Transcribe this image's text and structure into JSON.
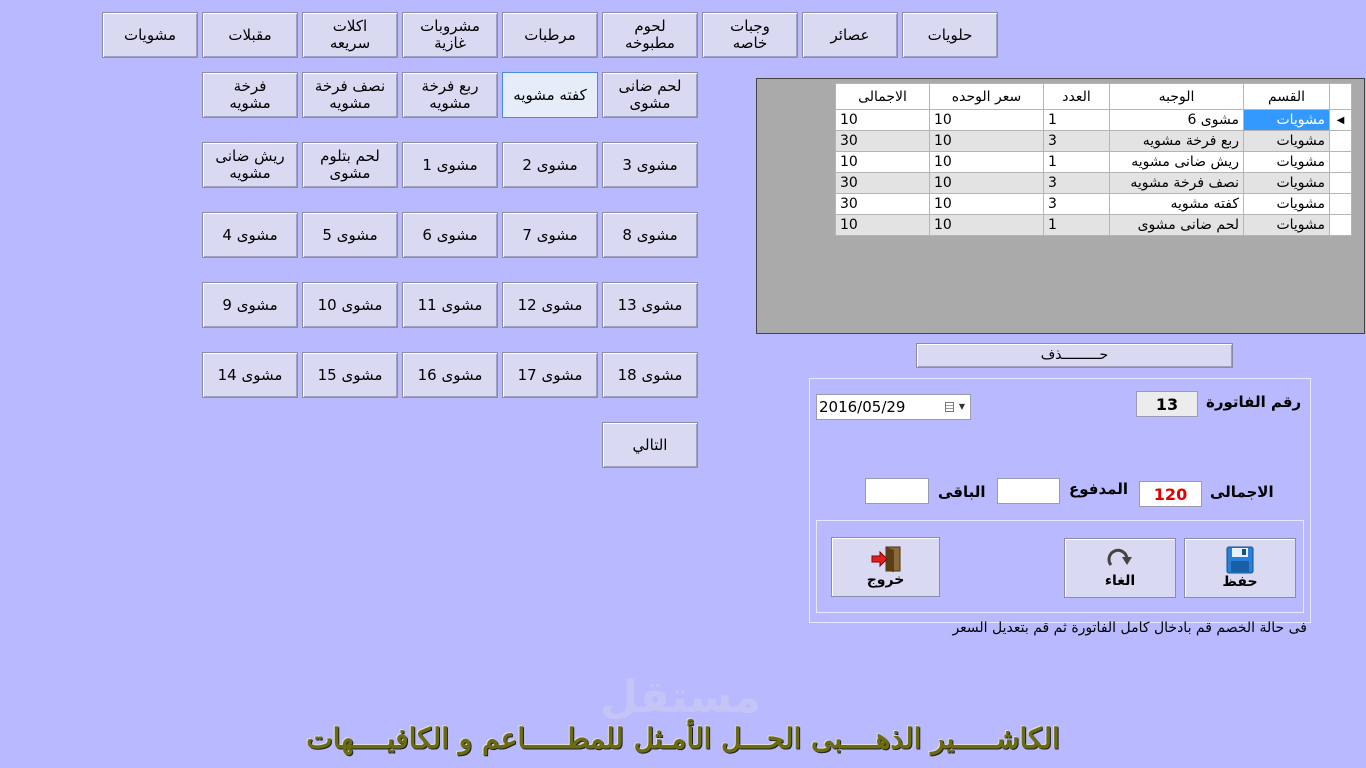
{
  "categories": [
    "حلويات",
    "عصائر",
    "وجبات\nخاصه",
    "لحوم\nمطبوخه",
    "مرطبات",
    "مشروبات\nغازية",
    "اكلات\nسريعه",
    "مقبلات",
    "مشويات"
  ],
  "items_row1": [
    "لحم ضانى\nمشوى",
    "كفته مشويه",
    "ربع فرخة\nمشويه",
    "نصف فرخة\nمشويه",
    "فرخة\nمشويه"
  ],
  "items_row2": [
    "مشوى 3",
    "مشوى 2",
    "مشوى 1",
    "لحم بتلوم\nمشوى",
    "ريش ضانى\nمشويه"
  ],
  "items_row3": [
    "مشوى 8",
    "مشوى 7",
    "مشوى 6",
    "مشوى 5",
    "مشوى 4"
  ],
  "items_row4": [
    "مشوى 13",
    "مشوى 12",
    "مشوى 11",
    "مشوى 10",
    "مشوى 9"
  ],
  "items_row5": [
    "مشوى 18",
    "مشوى 17",
    "مشوى 16",
    "مشوى 15",
    "مشوى 14"
  ],
  "next_label": "التالي",
  "grid": {
    "headers": [
      "القسم",
      "الوجبه",
      "العدد",
      "سعر الوحده",
      "الاجمالى"
    ],
    "rows": [
      [
        "مشويات",
        "مشوى 6",
        "1",
        "10",
        "10"
      ],
      [
        "مشويات",
        "ربع فرخة مشويه",
        "3",
        "10",
        "30"
      ],
      [
        "مشويات",
        "ريش ضانى مشويه",
        "1",
        "10",
        "10"
      ],
      [
        "مشويات",
        "نصف فرخة مشويه",
        "3",
        "10",
        "30"
      ],
      [
        "مشويات",
        "كفته مشويه",
        "3",
        "10",
        "30"
      ],
      [
        "مشويات",
        "لحم ضانى مشوى",
        "1",
        "10",
        "10"
      ]
    ]
  },
  "delete_label": "حـــــــــذف",
  "invoice": {
    "number_label": "رقم الفاتورة",
    "number_value": "13",
    "date_value": "2016/05/29",
    "total_label": "الاجمالى",
    "total_value": "120",
    "paid_label": "المدفوع",
    "paid_value": "",
    "remaining_label": "الباقى",
    "remaining_value": ""
  },
  "actions": {
    "save_label": "حفظ",
    "cancel_label": "الغاء",
    "exit_label": "خروج"
  },
  "note": "فى حالة الخصم قم بادخال كامل الفاتورة ثم قم بتعديل السعر",
  "watermark": "مستقل",
  "footer_title": "الكاشـــــير الذهــــبى الحـــل الأمـثل للمطـــــاعم و الكافيــــهات",
  "colors": {
    "background": "#b9b9ff",
    "selected_row": "#3399ff",
    "total_text": "#e00000"
  }
}
